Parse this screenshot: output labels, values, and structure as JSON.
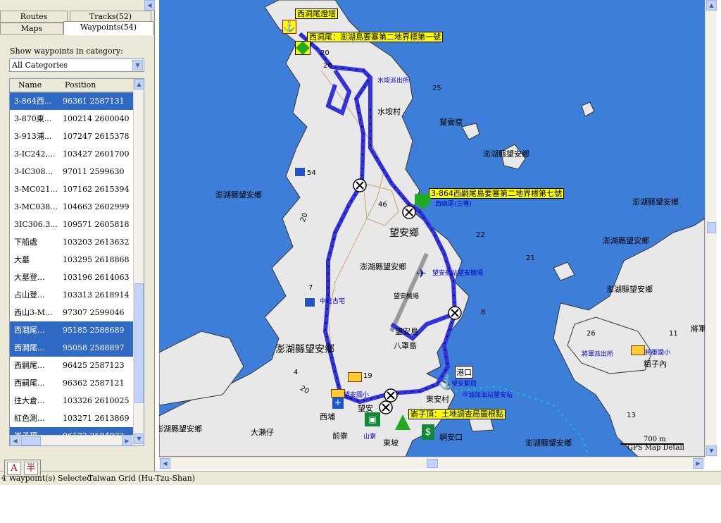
{
  "tabs": {
    "routes": "Routes",
    "tracks": "Tracks(52)",
    "maps": "Maps",
    "waypoints": "Waypoints(54)"
  },
  "category": {
    "label": "Show waypoints in category:",
    "value": "All Categories"
  },
  "list": {
    "headers": {
      "name": "Name",
      "position": "Position"
    },
    "rows": [
      {
        "name": "3-864西...",
        "pos": "96361 2587131",
        "sel": true
      },
      {
        "name": "3-870東...",
        "pos": "100214 2600040",
        "sel": false
      },
      {
        "name": "3-913浦...",
        "pos": "107247 2615378",
        "sel": false
      },
      {
        "name": "3-IC242,...",
        "pos": "103427 2601700",
        "sel": false
      },
      {
        "name": "3-IC308...",
        "pos": "97011 2599630",
        "sel": false
      },
      {
        "name": "3-MC021...",
        "pos": "107162 2615394",
        "sel": false
      },
      {
        "name": "3-MC038...",
        "pos": "104663 2602999",
        "sel": false
      },
      {
        "name": "3IC306.3...",
        "pos": "109571 2605818",
        "sel": false
      },
      {
        "name": "下船處",
        "pos": "103203 2613632",
        "sel": false
      },
      {
        "name": "大墓",
        "pos": "103295 2618868",
        "sel": false
      },
      {
        "name": "大墓登...",
        "pos": "103196 2614063",
        "sel": false
      },
      {
        "name": "占山登...",
        "pos": "103313 2618914",
        "sel": false
      },
      {
        "name": "西山3-M...",
        "pos": "97307 2599046",
        "sel": false
      },
      {
        "name": "西澗尾...",
        "pos": "95185 2588689",
        "sel": true
      },
      {
        "name": "西澗尾...",
        "pos": "95058 2588897",
        "sel": true
      },
      {
        "name": "西嗣尾...",
        "pos": "96425 2587123",
        "sel": false
      },
      {
        "name": "西嗣尾...",
        "pos": "96362 2587121",
        "sel": false
      },
      {
        "name": "往大倉...",
        "pos": "103326 2610025",
        "sel": false
      },
      {
        "name": "紅色測...",
        "pos": "103271 2613869",
        "sel": false
      },
      {
        "name": "嵛子頂...",
        "pos": "96172 2584973",
        "sel": true
      }
    ]
  },
  "status": {
    "selected": "4 Waypoint(s) Selected",
    "grid": "Taiwan Grid (Hu-Tzu-Shan)"
  },
  "ime": {
    "a": "A",
    "b": "半"
  },
  "scale": {
    "dist": "700 m",
    "detail": "GPS Map Detail"
  },
  "map": {
    "yellow": {
      "lighthouse": "西洞尾燈塔",
      "marker1": "西洞尾：澎湖島要塞第二地界標第一號",
      "marker7": "3-864西嗣尾島要塞第二地界標第七號",
      "bureau": "嵛子頂：土地調查局圖根點"
    },
    "places": {
      "shuikengcun": "水垵村",
      "yuanyangku": "鴛鴦窟",
      "wangan": "望安鄉",
      "wanganxiang": "澎湖縣望安鄉",
      "airport": "望安機場",
      "wangandao": "望安島",
      "bazhaodao": "八罩島",
      "bigcounty": "澎湖縣望安鄉",
      "dongancun": "東安村",
      "xipu": "西埔",
      "wangan2": "望安",
      "qianliao": "前寮",
      "dongpo": "東坡",
      "wanganko": "網安口",
      "dalaizai": "大瀨仔",
      "gangkou": "港口",
      "zhuzainei": "粗子內",
      "jiang": "將軍",
      "c1": "澎湖縣望安鄉",
      "c2": "澎湖縣望安鄉",
      "c3": "澎湖縣望安鄉",
      "c4": "澎湖縣望安鄉",
      "c5": "澎湖縣望安鄉",
      "c6": "澎湖縣望安鄉",
      "c7": "澎湖縣望安鄉"
    },
    "blue": {
      "police1": "水垵派出所",
      "airportlabel": "望安航站望安機場",
      "ancient": "中社古宅",
      "school": "望安國小",
      "post": "望安郵局",
      "gas": "中油加油站望安站",
      "police2": "將軍派出所",
      "school2": "將軍國小",
      "hua": "西嶼尾(三等)",
      "shanliao": "山寮"
    },
    "nums": {
      "n20a": "20",
      "n20b": "20",
      "n25": "25",
      "n54": "54",
      "n46": "46",
      "n20c": "20",
      "n22": "22",
      "n21": "21",
      "n7": "7",
      "n8": "8",
      "n19": "19",
      "n4": "4",
      "n20d": "20",
      "n26": "26",
      "n11": "11",
      "n13": "13"
    }
  }
}
